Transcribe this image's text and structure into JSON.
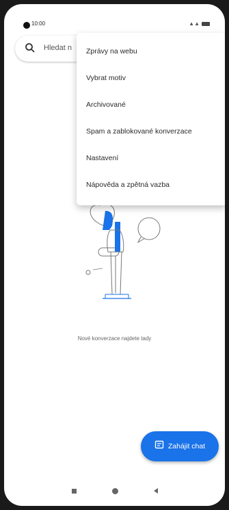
{
  "status_bar": {
    "time": "10:00"
  },
  "search": {
    "placeholder": "Hledat n"
  },
  "menu": {
    "items": [
      "Zprávy na webu",
      "Vybrat motiv",
      "Archivované",
      "Spam a zablokované konverzace",
      "Nastavení",
      "Nápověda a zpětná vazba"
    ]
  },
  "empty_state": {
    "text": "Nové konverzace najdete tady"
  },
  "fab": {
    "label": "Zahájit chat",
    "color": "#1a73e8"
  },
  "icons": {
    "search": "search-icon",
    "chat": "chat-icon",
    "recents": "recents-icon",
    "home": "home-icon",
    "back": "back-icon"
  }
}
